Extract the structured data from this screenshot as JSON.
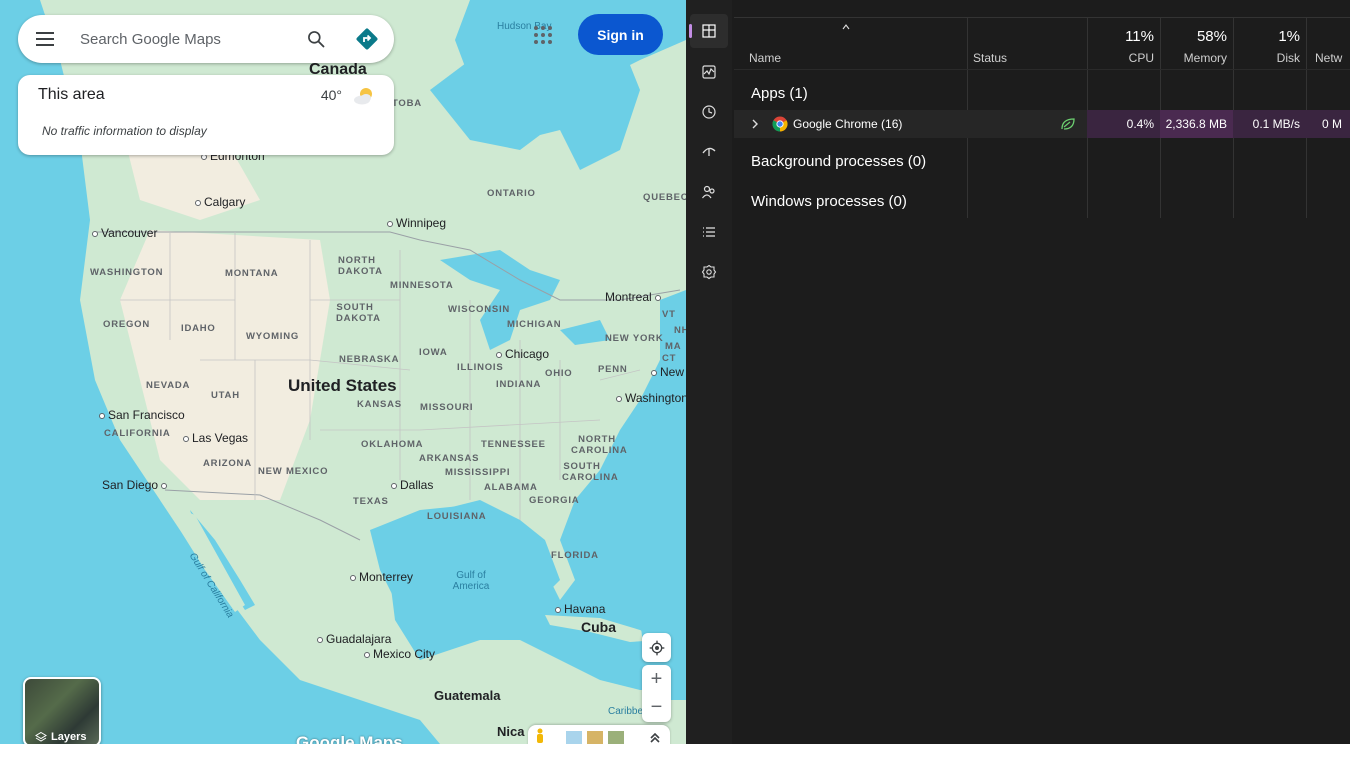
{
  "colors": {
    "signin_blue": "#0b57d0",
    "tm_bg": "#1c1c1c",
    "tm_rail": "#202020",
    "memory_highlight": "#4a2a50",
    "cpu_highlight": "#3a2540",
    "accent_purple": "#c48ee6",
    "map_water": "#6ccfe6"
  },
  "maps": {
    "search": {
      "placeholder": "Search Google Maps",
      "menu_icon": "hamburger-icon",
      "search_icon": "search-icon",
      "directions_icon": "directions-icon"
    },
    "area_card": {
      "title": "This area",
      "temperature": "40°",
      "weather_icon": "partly-cloudy-icon",
      "note": "No traffic information to display"
    },
    "signin_label": "Sign in",
    "apps_icon": "apps-grid-icon",
    "layers_label": "Layers",
    "logo_text": "Google Maps",
    "labels": {
      "countries": [
        "Canada",
        "United States",
        "Cuba",
        "Guatemala",
        "Nica"
      ],
      "states": [
        "WASHINGTON",
        "OREGON",
        "IDAHO",
        "MONTANA",
        "WYOMING",
        "NEVADA",
        "UTAH",
        "CALIFORNIA",
        "ARIZONA",
        "NEW MEXICO",
        "NORTH DAKOTA",
        "SOUTH DAKOTA",
        "NEBRASKA",
        "KANSAS",
        "OKLAHOMA",
        "TEXAS",
        "MINNESOTA",
        "IOWA",
        "MISSOURI",
        "ARKANSAS",
        "LOUISIANA",
        "WISCONSIN",
        "ILLINOIS",
        "MICHIGAN",
        "INDIANA",
        "OHIO",
        "TENNESSEE",
        "MISSISSIPPI",
        "ALABAMA",
        "GEORGIA",
        "FLORIDA",
        "SOUTH CAROLINA",
        "NORTH CAROLINA",
        "PENN",
        "NEW YORK",
        "VT",
        "NH",
        "MA",
        "CT",
        "ONTARIO",
        "QUEBEC",
        "TOBA"
      ],
      "cities": [
        "Edmonton",
        "Calgary",
        "Vancouver",
        "Winnipeg",
        "Montreal",
        "Chicago",
        "San Francisco",
        "Las Vegas",
        "San Diego",
        "Dallas",
        "Washington",
        "New",
        "Monterrey",
        "Guadalajara",
        "Mexico City",
        "Havana"
      ],
      "water": [
        "Hudson Bay",
        "Gulf of America",
        "Gulf of California",
        "Caribbe"
      ]
    }
  },
  "taskmgr": {
    "rail": [
      "processes-icon",
      "performance-icon",
      "app-history-icon",
      "startup-apps-icon",
      "users-icon",
      "details-icon",
      "services-icon"
    ],
    "columns": {
      "name": "Name",
      "status": "Status",
      "cpu": {
        "pct": "11%",
        "label": "CPU"
      },
      "memory": {
        "pct": "58%",
        "label": "Memory"
      },
      "disk": {
        "pct": "1%",
        "label": "Disk"
      },
      "network": {
        "label": "Netw"
      }
    },
    "groups": {
      "apps": "Apps (1)",
      "background": "Background processes (0)",
      "windows": "Windows processes (0)"
    },
    "process": {
      "name": "Google Chrome (16)",
      "status_icon": "efficiency-mode-leaf-icon",
      "cpu": "0.4%",
      "memory": "2,336.8 MB",
      "disk": "0.1 MB/s",
      "network": "0 M"
    }
  }
}
